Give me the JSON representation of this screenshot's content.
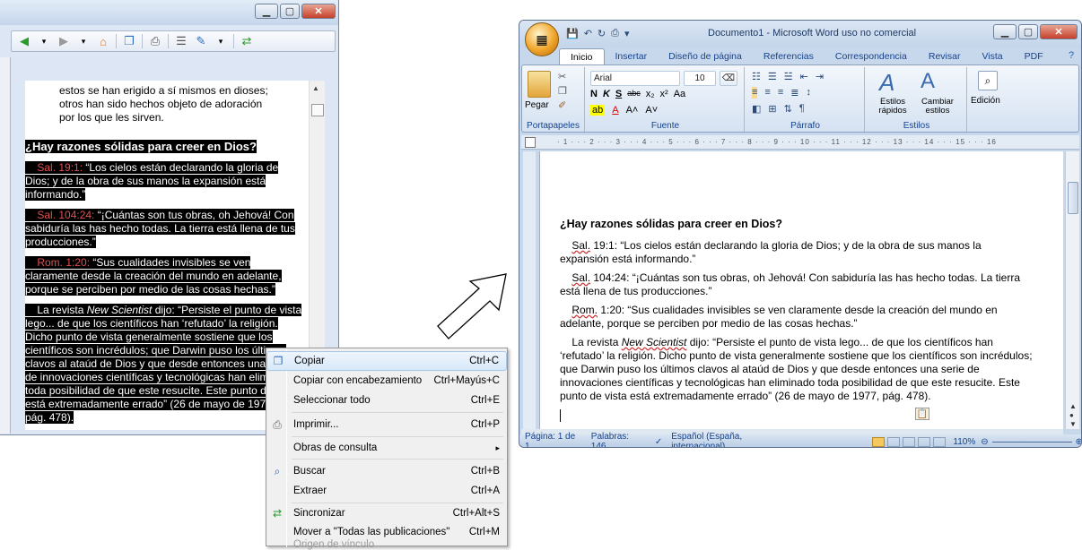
{
  "left_window": {
    "text_top": [
      "estos se han erigido a sí mismos en dioses;",
      "otros han sido hechos objeto de adoración",
      "por los que les sirven."
    ],
    "heading": "¿Hay razones sólidas para creer en Dios?",
    "ref1": "Sal. 19:1:",
    "ref1_text_a": " “Los cielos están declarando la gloria de",
    "ref1_text_b": "Dios; y de la obra de sus manos la expansión está",
    "ref1_text_c": "informando.”",
    "ref2": "Sal. 104:24:",
    "ref2_text_a": " “¡Cuántas son tus obras, oh Jehová! Con",
    "ref2_text_b": "sabiduría las has hecho todas. La tierra está llena de tus",
    "ref2_text_c": "producciones.”",
    "ref3": "Rom. 1:20:",
    "ref3_text_a": " “Sus cualidades invisibles se ven",
    "ref3_text_b": "claramente desde la creación del mundo en adelante,",
    "ref3_text_c": "porque se perciben por medio de las cosas hechas.”",
    "para_a": "La revista ",
    "para_ns": "New Scientist",
    "para_b": " dijo: “Persiste el punto de vista",
    "para_lines": [
      "lego... de que los científicos han ‘refutado’ la religión.",
      "Dicho punto de vista generalmente sostiene que los",
      "científicos son incrédulos; que Darwin puso los últimos",
      "clavos al ataúd de Dios y que desde entonces una",
      "de innovaciones científicas y tecnológicas han elim",
      "toda posibilidad de que este resucite. Este punto d",
      "está extremadamente errado” (26 de mayo de 197",
      "pág. 478)."
    ]
  },
  "context_menu": {
    "items": [
      {
        "label": "Copiar",
        "shortcut": "Ctrl+C",
        "icon": "copy-icon"
      },
      {
        "label": "Copiar con encabezamiento",
        "shortcut": "Ctrl+Mayús+C"
      },
      {
        "label": "Seleccionar todo",
        "shortcut": "Ctrl+E"
      },
      {
        "label": "Imprimir...",
        "shortcut": "Ctrl+P",
        "icon": "print-icon"
      },
      {
        "label": "Obras de consulta",
        "shortcut": "▸"
      },
      {
        "label": "Buscar",
        "shortcut": "Ctrl+B",
        "icon": "search-icon"
      },
      {
        "label": "Extraer",
        "shortcut": "Ctrl+A"
      },
      {
        "label": "Sincronizar",
        "shortcut": "Ctrl+Alt+S",
        "icon": "sync-icon"
      },
      {
        "label": "Mover a \"Todas las publicaciones\"",
        "shortcut": "Ctrl+M"
      },
      {
        "label": "Origen de vínculo",
        "shortcut": ""
      }
    ]
  },
  "word": {
    "title": "Documento1 - Microsoft Word uso no comercial",
    "tabs": [
      "Inicio",
      "Insertar",
      "Diseño de página",
      "Referencias",
      "Correspondencia",
      "Revisar",
      "Vista",
      "PDF"
    ],
    "font_name": "Arial",
    "font_size": "10",
    "paste_label": "Pegar",
    "styles_label": "Estilos rápidos",
    "change_styles_label": "Cambiar estilos",
    "edit_label": "Edición",
    "groups": [
      "Portapapeles",
      "Fuente",
      "Párrafo",
      "Estilos"
    ],
    "heading": "¿Hay razones sólidas para creer en Dios?",
    "p1_ref": "Sal.",
    "p1_a": " 19:1: “Los cielos están declarando la gloria de Dios; y de la obra de sus manos la",
    "p1_b": "expansión está informando.”",
    "p2_ref": "Sal.",
    "p2_a": " 104:24: “¡Cuántas son tus obras, oh Jehová! Con sabiduría las has hecho todas. La tierra",
    "p2_b": "está llena de tus producciones.”",
    "p3_ref": "Rom.",
    "p3_a": " 1:20: “Sus cualidades invisibles se ven claramente desde la creación del mundo en",
    "p3_b": "adelante, porque se perciben por medio de las cosas hechas.”",
    "p4_a": "La revista ",
    "p4_ns": "New Scientist",
    "p4_b": " dijo: “Persiste el punto de vista lego... de que los científicos han",
    "p4_lines": [
      "‘refutado’ la religión. Dicho punto de vista generalmente sostiene que los científicos son incrédulos;",
      "que Darwin puso los últimos clavos al ataúd de Dios y que desde entonces una serie de",
      "innovaciones científicas y tecnológicas han eliminado toda posibilidad de que este resucite. Este",
      "punto de vista está extremadamente errado” (26 de mayo de 1977, pág. 478)."
    ],
    "status_page": "Página: 1 de 1",
    "status_words": "Palabras: 146",
    "status_lang": "Español (España, internacional)",
    "zoom": "110%"
  }
}
